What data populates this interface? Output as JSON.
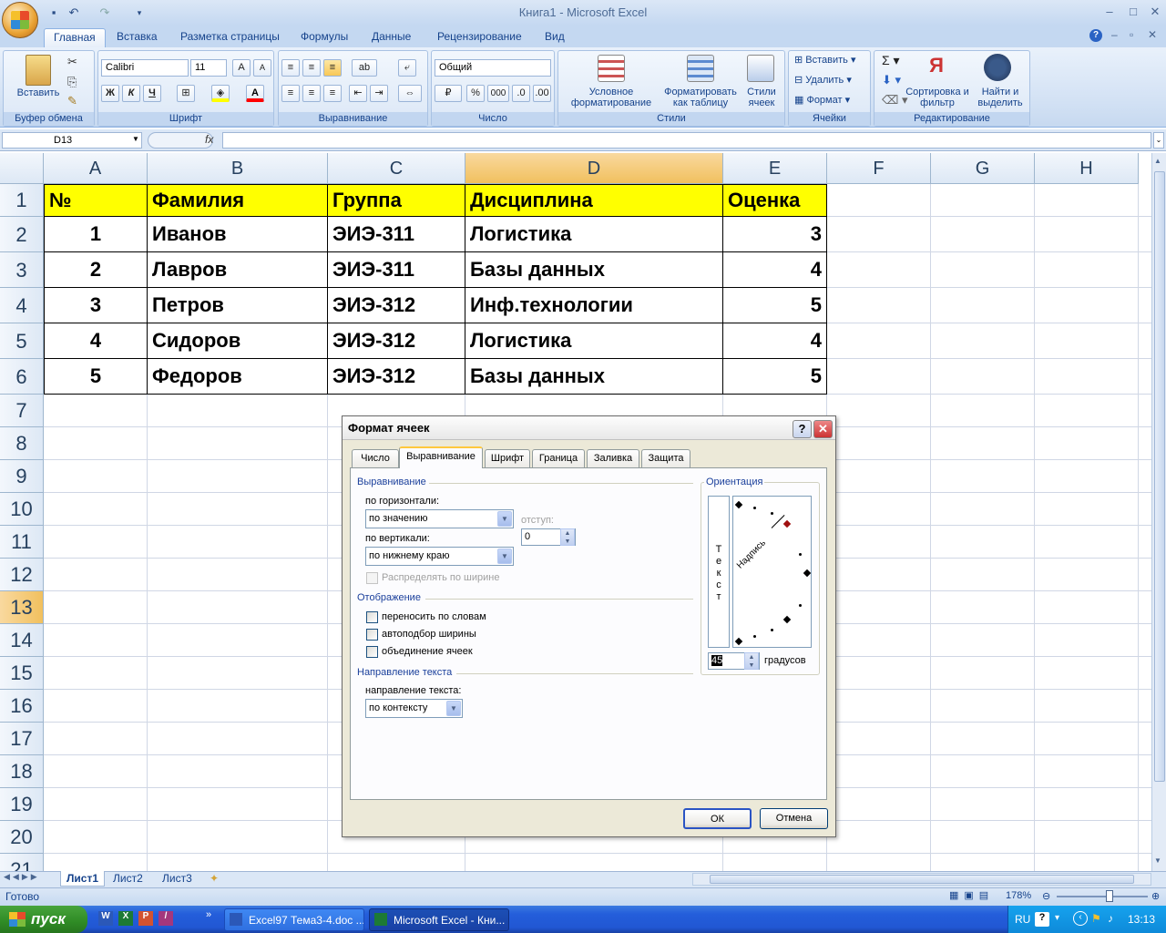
{
  "window": {
    "title": "Книга1 - Microsoft Excel"
  },
  "ribbon_tabs": [
    "Главная",
    "Вставка",
    "Разметка страницы",
    "Формулы",
    "Данные",
    "Рецензирование",
    "Вид"
  ],
  "clipboard": {
    "paste_label": "Вставить",
    "group": "Буфер обмена"
  },
  "font": {
    "name": "Calibri",
    "size": "11",
    "group": "Шрифт",
    "bold": "Ж",
    "italic": "К",
    "underline": "Ч"
  },
  "alignment": {
    "group": "Выравнивание"
  },
  "number": {
    "format": "Общий",
    "group": "Число",
    "percent": "%",
    "thousands": "000"
  },
  "styles": {
    "conditional": "Условное форматирование",
    "as_table": "Форматировать как таблицу",
    "cell_styles": "Стили ячеек",
    "group": "Стили"
  },
  "cells": {
    "insert": "Вставить",
    "delete": "Удалить",
    "format": "Формат",
    "group": "Ячейки"
  },
  "editing": {
    "sort": "Сортировка и фильтр",
    "find": "Найти и выделить",
    "group": "Редактирование"
  },
  "formula_bar": {
    "name_box": "D13",
    "fx": "fx",
    "value": ""
  },
  "columns": [
    "A",
    "B",
    "C",
    "D",
    "E",
    "F",
    "G",
    "H"
  ],
  "rows": [
    "1",
    "2",
    "3",
    "4",
    "5",
    "6",
    "7",
    "8",
    "9",
    "10",
    "11",
    "12",
    "13",
    "14",
    "15",
    "16",
    "17",
    "18",
    "19",
    "20",
    "21"
  ],
  "table": {
    "headers": [
      "№",
      "Фамилия",
      "Группа",
      "Дисциплина",
      "Оценка"
    ],
    "rows": [
      [
        "1",
        "Иванов",
        "ЭИЭ-311",
        "Логистика",
        "3"
      ],
      [
        "2",
        "Лавров",
        "ЭИЭ-311",
        "Базы данных",
        "4"
      ],
      [
        "3",
        "Петров",
        "ЭИЭ-312",
        "Инф.технологии",
        "5"
      ],
      [
        "4",
        "Сидоров",
        "ЭИЭ-312",
        "Логистика",
        "4"
      ],
      [
        "5",
        "Федоров",
        "ЭИЭ-312",
        "Базы данных",
        "5"
      ]
    ]
  },
  "sheets": [
    "Лист1",
    "Лист2",
    "Лист3"
  ],
  "status": {
    "ready": "Готово",
    "zoom": "178%"
  },
  "dialog": {
    "title": "Формат ячеек",
    "tabs": [
      "Число",
      "Выравнивание",
      "Шрифт",
      "Граница",
      "Заливка",
      "Защита"
    ],
    "active_tab": "Выравнивание",
    "section_alignment": "Выравнивание",
    "horizontal_label": "по горизонтали:",
    "horizontal_value": "по значению",
    "indent_label": "отступ:",
    "indent_value": "0",
    "vertical_label": "по вертикали:",
    "vertical_value": "по нижнему краю",
    "distribute_label": "Распределять по ширине",
    "section_display": "Отображение",
    "wrap_label": "переносить по словам",
    "autofit_label": "автоподбор ширины",
    "merge_label": "объединение ячеек",
    "section_direction": "Направление текста",
    "direction_label": "направление текста:",
    "direction_value": "по контексту",
    "orientation_label": "Ориентация",
    "vertical_text": "Текст",
    "rotated_text": "Надпись",
    "degrees_value": "45",
    "degrees_label": "градусов",
    "ok": "ОК",
    "cancel": "Отмена"
  },
  "taskbar": {
    "start": "пуск",
    "tasks": [
      "Excel97 Тема3-4.doc ...",
      "Microsoft Excel - Кни..."
    ],
    "lang": "RU",
    "time": "13:13"
  }
}
